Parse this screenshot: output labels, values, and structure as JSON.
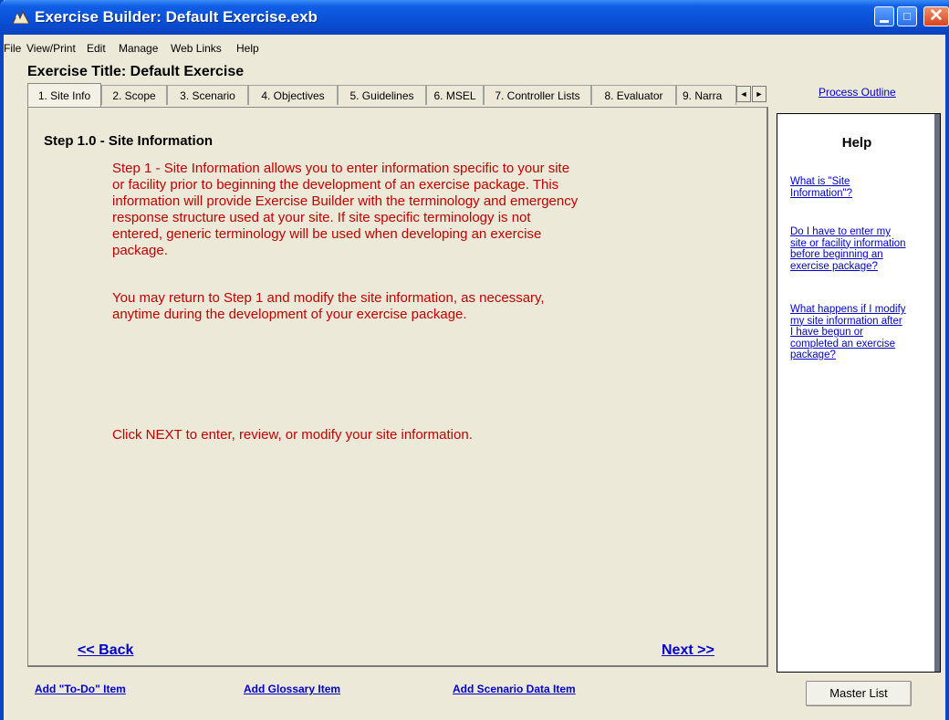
{
  "window": {
    "title": "Exercise Builder: Default Exercise.exb"
  },
  "menu": [
    "File",
    "View/Print",
    "Edit",
    "Manage",
    "Web Links",
    "Help"
  ],
  "exercise_title": "Exercise Title: Default Exercise",
  "tabs": [
    "1. Site Info",
    "2. Scope",
    "3. Scenario",
    "4. Objectives",
    "5. Guidelines",
    "6. MSEL",
    "7. Controller Lists",
    "8. Evaluator",
    "9. Narra"
  ],
  "tab_scroll": {
    "left": "◄",
    "right": "►"
  },
  "content": {
    "heading": "Step 1.0 - Site Information",
    "paragraph1_lines": [
      "Step 1 - Site Information allows you to enter information specific to your site",
      "or facility prior to beginning the development of an exercise package.  This",
      "information will provide Exercise Builder with the terminology and emergency",
      "response structure used at your site.   If site specific terminology is not",
      "entered, generic terminology will be used when developing an exercise",
      "package."
    ],
    "paragraph2_lines": [
      "You may return to Step 1 and modify the site information, as necessary,",
      "anytime during the development of your exercise package."
    ],
    "instruction": "Click NEXT to enter, review, or modify your site information.",
    "back_link": "<< Back",
    "next_link": "Next >>"
  },
  "process_outline": "Process Outline",
  "help": {
    "title": "Help",
    "link1_lines": [
      "What is \"Site",
      "Information\"?"
    ],
    "link2_lines": [
      "Do I have to enter my",
      "site or facility information",
      "before beginning an",
      "exercise package?"
    ],
    "link3_lines": [
      "What happens if I modify",
      "my site information after",
      "I have begun or",
      "completed an exercise",
      "package?"
    ]
  },
  "footer": {
    "todo_link": "Add \"To-Do\" Item",
    "glossary_link": "Add Glossary Item",
    "scenario_link": "Add Scenario Data Item",
    "master_list": "Master List"
  },
  "colors": {
    "accent_text": "#c00000",
    "link": "#0000cc",
    "titlebar": "#0a52d8"
  }
}
